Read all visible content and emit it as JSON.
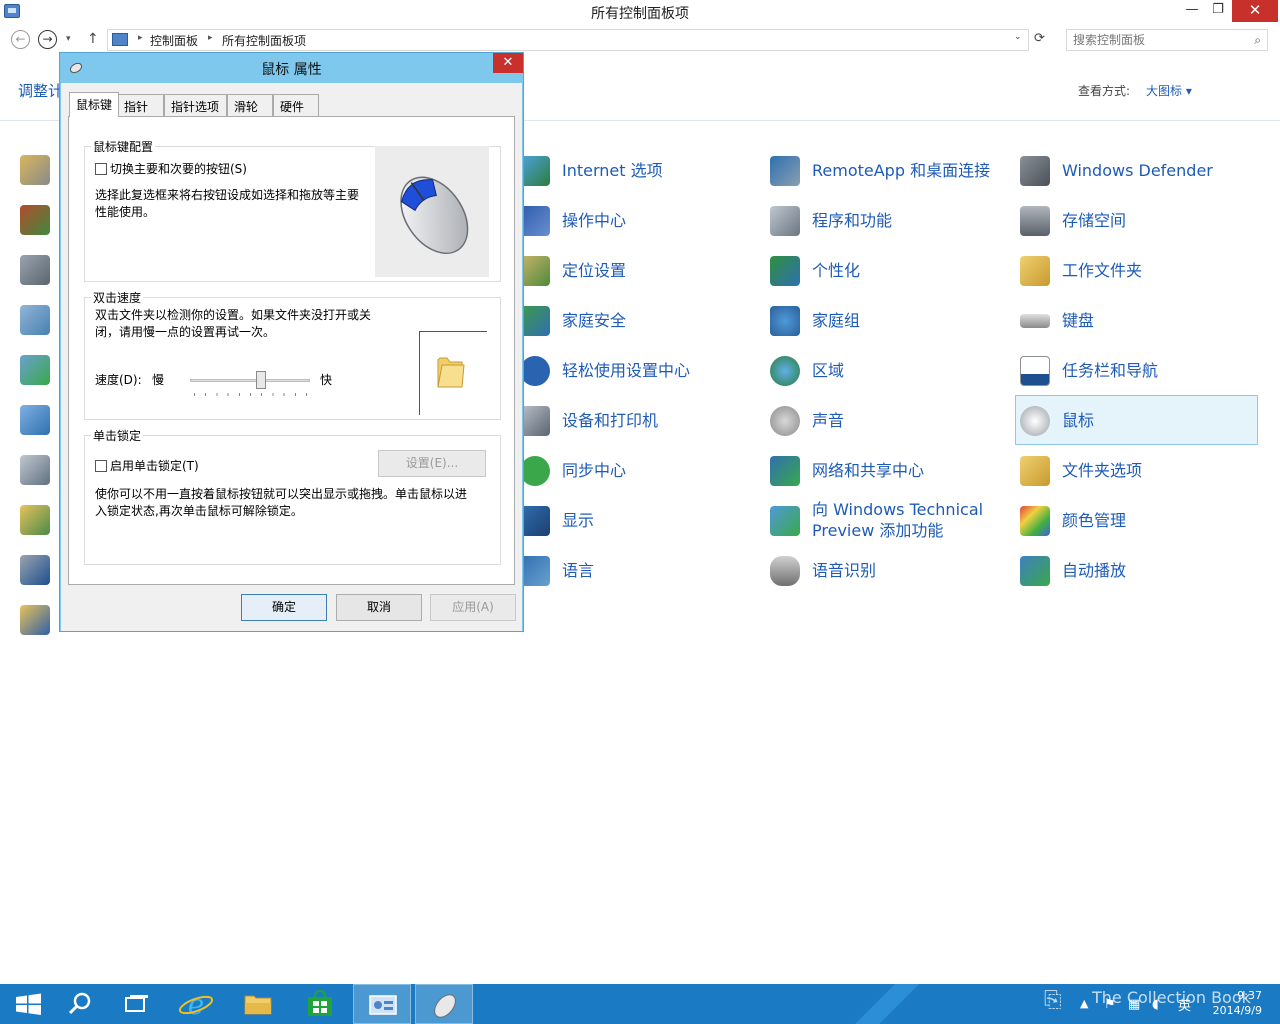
{
  "window": {
    "title": "所有控制面板项",
    "minimize": "—",
    "maximize": "❐",
    "close": "✕"
  },
  "nav": {
    "back": "←",
    "forward": "→",
    "history_dropdown": "▾",
    "up": "↑",
    "breadcrumb_sep": "▸",
    "breadcrumbs": [
      "控制面板",
      "所有控制面板项"
    ],
    "address_dropdown": "⌄",
    "refresh": "⟳",
    "search_placeholder": "搜索控制面板",
    "search_icon": "⌕"
  },
  "header": {
    "adjust_link": "调整计",
    "view_label": "查看方式:",
    "view_value": "大图标 ▾"
  },
  "items": {
    "col1": [
      "Internet 选项",
      "操作中心",
      "定位设置",
      "家庭安全",
      "轻松使用设置中心",
      "设备和打印机",
      "同步中心",
      "显示",
      "语言"
    ],
    "col2": [
      "RemoteApp 和桌面连接",
      "程序和功能",
      "个性化",
      "家庭组",
      "区域",
      "声音",
      "网络和共享中心",
      "向 Windows Technical Preview 添加功能",
      "语音识别"
    ],
    "col3": [
      "Windows Defender",
      "存储空间",
      "工作文件夹",
      "键盘",
      "任务栏和导航",
      "鼠标",
      "文件夹选项",
      "颜色管理",
      "自动播放"
    ]
  },
  "dialog": {
    "title": "鼠标 属性",
    "close": "✕",
    "tabs": [
      "鼠标键",
      "指针",
      "指针选项",
      "滑轮",
      "硬件"
    ],
    "button_config": {
      "legend": "鼠标键配置",
      "swap_label": "切换主要和次要的按钮(S)",
      "swap_checked": false,
      "desc": "选择此复选框来将右按钮设成如选择和拖放等主要性能使用。"
    },
    "double_click": {
      "legend": "双击速度",
      "desc": "双击文件夹以检测你的设置。如果文件夹没打开或关闭，请用慢一点的设置再试一次。",
      "speed_label": "速度(D):",
      "slow": "慢",
      "fast": "快",
      "speed_value": 0.6
    },
    "click_lock": {
      "legend": "单击锁定",
      "enable_label": "启用单击锁定(T)",
      "enable_checked": false,
      "settings_button": "设置(E)...",
      "desc": "使你可以不用一直按着鼠标按钮就可以突出显示或拖拽。单击鼠标以进入锁定状态,再次单击鼠标可解除锁定。"
    },
    "buttons": {
      "ok": "确定",
      "cancel": "取消",
      "apply": "应用(A)"
    }
  },
  "taskbar": {
    "time": "9:37",
    "date": "2014/9/9",
    "ime": "英",
    "watermark": "The Collection Book",
    "up_arrow": "▲"
  },
  "colors": {
    "link_blue": "#1e5bb8",
    "taskbar": "#1a7bc4",
    "dialog_frame": "#7ec8ee",
    "close_red": "#c7302b"
  }
}
